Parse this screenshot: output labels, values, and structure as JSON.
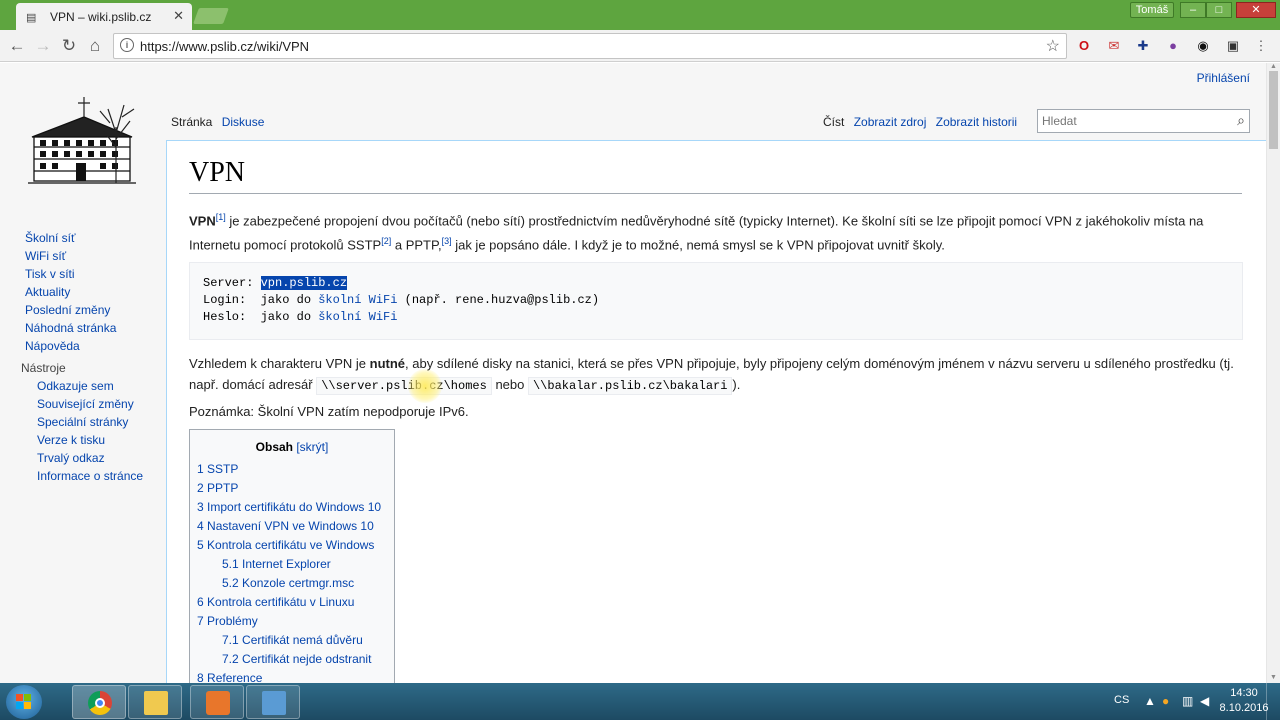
{
  "browser": {
    "tab_title": "VPN – wiki.pslib.cz",
    "profile_name": "Tomáš",
    "url": "https://www.pslib.cz/wiki/VPN"
  },
  "wiki": {
    "login_link": "Přihlášení",
    "tabs_left": [
      "Stránka",
      "Diskuse"
    ],
    "tabs_right": [
      "Číst",
      "Zobrazit zdroj",
      "Zobrazit historii"
    ],
    "search_placeholder": "Hledat",
    "sidebar_nav": [
      "Školní síť",
      "WiFi síť",
      "Tisk v síti",
      "Aktuality",
      "Poslední změny",
      "Náhodná stránka",
      "Nápověda"
    ],
    "tools_heading": "Nástroje",
    "tools": [
      "Odkazuje sem",
      "Související změny",
      "Speciální stránky",
      "Verze k tisku",
      "Trvalý odkaz",
      "Informace o stránce"
    ]
  },
  "article": {
    "title": "VPN",
    "intro": {
      "term": "VPN",
      "ref1": "[1]",
      "text1": " je zabezpečené propojení dvou počítačů (nebo sítí) prostřednictvím nedůvěryhodné sítě (typicky Internet). Ke školní síti se lze připojit pomocí VPN z jakéhokoliv místa na Internetu pomocí protokolů SSTP",
      "ref2": "[2]",
      "text2": " a PPTP,",
      "ref3": "[3]",
      "text3": " jak je popsáno dále. I když je to možné, nemá smysl se k VPN připojovat uvnitř školy."
    },
    "pre": {
      "server_label": "Server: ",
      "server_value": "vpn.pslib.cz",
      "login_label": "Login:  jako do ",
      "login_link": "školní WiFi",
      "login_suffix": " (např. rene.huzva@pslib.cz)",
      "password_label": "Heslo:  jako do ",
      "password_link": "školní WiFi"
    },
    "para2": {
      "t1": "Vzhledem k charakteru VPN je ",
      "bold": "nutné",
      "t2": ", aby sdílené disky na stanici, která se přes VPN připojuje, byly připojeny celým doménovým jménem v názvu serveru u sdíleného prostředku (tj. např. domácí adresář ",
      "code1": "\\\\server.pslib.cz\\homes",
      "t3": " nebo ",
      "code2": "\\\\bakalar.pslib.cz\\bakalari",
      "t4": ")."
    },
    "note": "Poznámka: Školní VPN zatím nepodporuje IPv6.",
    "toc": {
      "title": "Obsah",
      "hide": "[skrýt]",
      "items": [
        {
          "num": "1",
          "label": "SSTP",
          "sub": false
        },
        {
          "num": "2",
          "label": "PPTP",
          "sub": false
        },
        {
          "num": "3",
          "label": "Import certifikátu do Windows 10",
          "sub": false
        },
        {
          "num": "4",
          "label": "Nastavení VPN ve Windows 10",
          "sub": false
        },
        {
          "num": "5",
          "label": "Kontrola certifikátu ve Windows",
          "sub": false
        },
        {
          "num": "5.1",
          "label": "Internet Explorer",
          "sub": true
        },
        {
          "num": "5.2",
          "label": "Konzole certmgr.msc",
          "sub": true
        },
        {
          "num": "6",
          "label": "Kontrola certifikátu v Linuxu",
          "sub": false
        },
        {
          "num": "7",
          "label": "Problémy",
          "sub": false
        },
        {
          "num": "7.1",
          "label": "Certifikát nemá důvěru",
          "sub": true
        },
        {
          "num": "7.2",
          "label": "Certifikát nejde odstranit",
          "sub": true
        },
        {
          "num": "8",
          "label": "Reference",
          "sub": false
        }
      ]
    }
  },
  "taskbar": {
    "language": "CS",
    "time": "14:30",
    "date": "8.10.2016"
  },
  "colors": {
    "chrome_green": "#5ea53f",
    "link": "#0645ad",
    "taskbar": "#2e6a88"
  }
}
